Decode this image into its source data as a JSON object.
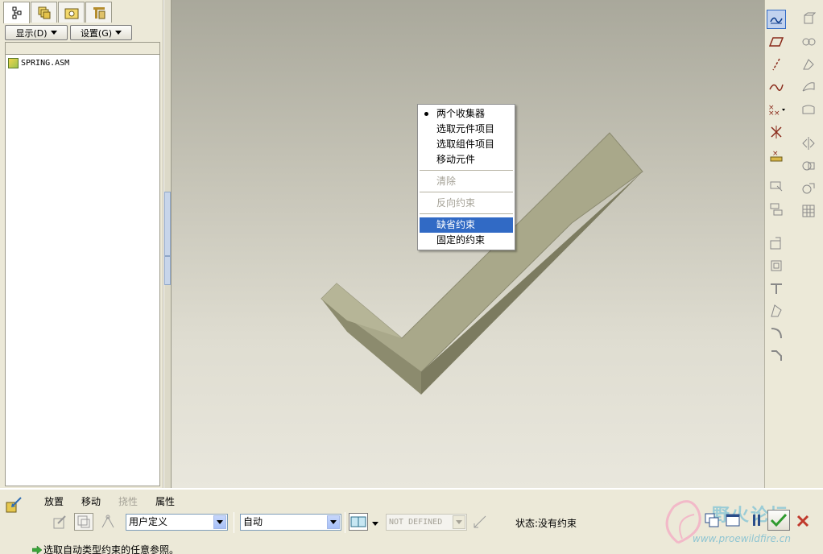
{
  "navigator": {
    "tabs": [
      "model-tree-icon",
      "layers-icon",
      "folder-icon",
      "favorites-icon"
    ],
    "display_label": "显示(D)",
    "settings_label": "设置(G)",
    "tree_items": [
      "SPRING.ASM"
    ]
  },
  "context_menu": {
    "items": [
      {
        "label": "两个收集器",
        "state": "bullet"
      },
      {
        "label": "选取元件项目",
        "state": "normal"
      },
      {
        "label": "选取组件项目",
        "state": "normal"
      },
      {
        "label": "移动元件",
        "state": "normal"
      },
      {
        "label": "清除",
        "state": "disabled"
      },
      {
        "label": "反向约束",
        "state": "disabled"
      },
      {
        "label": "缺省约束",
        "state": "selected"
      },
      {
        "label": "固定的约束",
        "state": "normal"
      }
    ]
  },
  "dashboard": {
    "tabs": [
      {
        "label": "放置",
        "disabled": false
      },
      {
        "label": "移动",
        "disabled": false
      },
      {
        "label": "挠性",
        "disabled": true
      },
      {
        "label": "属性",
        "disabled": false
      }
    ],
    "constraint_set": "用户定义",
    "constraint_type": "自动",
    "offset_value": "NOT DEFINED",
    "status": "状态:没有约束",
    "message": "选取自动类型约束的任意参照。"
  },
  "watermark": {
    "url": "www.proewildfire.cn",
    "logo": "野火论坛"
  },
  "colors": {
    "selection": "#316ac5",
    "model": "#9d9c7e",
    "accent_green": "#2f9a2f",
    "cancel_red": "#c0392b"
  }
}
